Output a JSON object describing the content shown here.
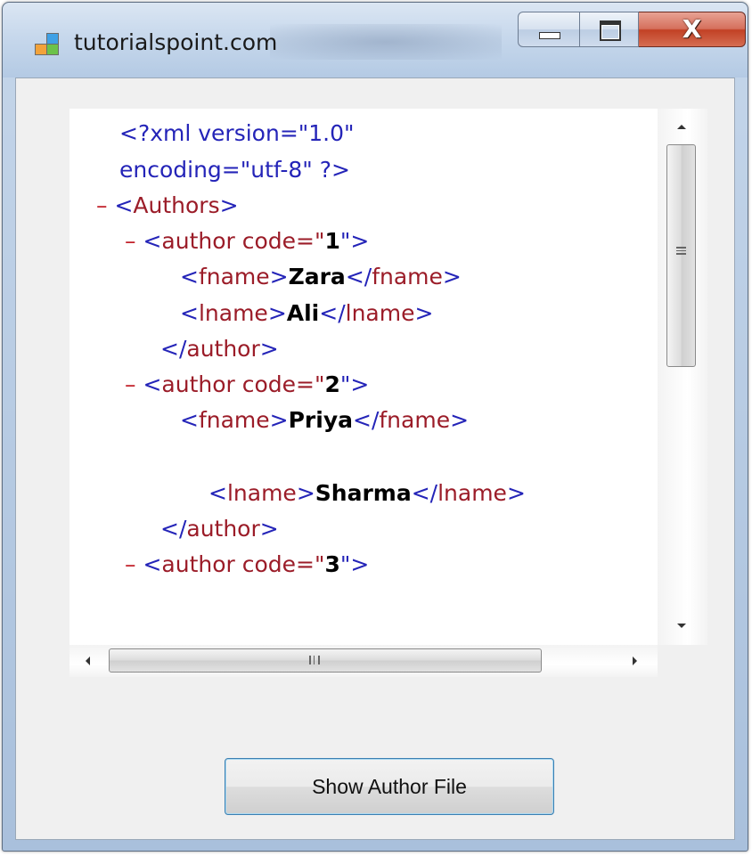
{
  "window": {
    "title": "tutorialspoint.com",
    "controls": {
      "minimize": "minimize",
      "maximize": "maximize",
      "close": "X"
    }
  },
  "xml_view": {
    "lines": [
      {
        "parts": [
          {
            "t": "<?xml version=\"1.0\"",
            "c": "b"
          }
        ]
      },
      {
        "parts": [
          {
            "t": "encoding=\"utf-8\" ?>",
            "c": "b"
          }
        ]
      },
      {
        "parts": [
          {
            "t": "– ",
            "c": "minus"
          },
          {
            "t": "<",
            "c": "b"
          },
          {
            "t": "Authors",
            "c": "r"
          },
          {
            "t": ">",
            "c": "b"
          }
        ]
      },
      {
        "parts": [
          {
            "t": "– ",
            "c": "minus"
          },
          {
            "t": "<",
            "c": "b"
          },
          {
            "t": "author",
            "c": "r"
          },
          {
            "t": " code=\"",
            "c": "r"
          },
          {
            "t": "1",
            "c": "k"
          },
          {
            "t": "\">",
            "c": "b"
          }
        ]
      },
      {
        "parts": [
          {
            "t": "<",
            "c": "b"
          },
          {
            "t": "fname",
            "c": "r"
          },
          {
            "t": ">",
            "c": "b"
          },
          {
            "t": "Zara",
            "c": "k"
          },
          {
            "t": "</",
            "c": "b"
          },
          {
            "t": "fname",
            "c": "r"
          },
          {
            "t": ">",
            "c": "b"
          }
        ]
      },
      {
        "parts": [
          {
            "t": "<",
            "c": "b"
          },
          {
            "t": "lname",
            "c": "r"
          },
          {
            "t": ">",
            "c": "b"
          },
          {
            "t": "Ali",
            "c": "k"
          },
          {
            "t": "</",
            "c": "b"
          },
          {
            "t": "lname",
            "c": "r"
          },
          {
            "t": ">",
            "c": "b"
          }
        ]
      },
      {
        "parts": [
          {
            "t": "</",
            "c": "b"
          },
          {
            "t": "author",
            "c": "r"
          },
          {
            "t": ">",
            "c": "b"
          }
        ]
      },
      {
        "parts": [
          {
            "t": "– ",
            "c": "minus"
          },
          {
            "t": "<",
            "c": "b"
          },
          {
            "t": "author",
            "c": "r"
          },
          {
            "t": " code=\"",
            "c": "r"
          },
          {
            "t": "2",
            "c": "k"
          },
          {
            "t": "\">",
            "c": "b"
          }
        ]
      },
      {
        "parts": [
          {
            "t": "<",
            "c": "b"
          },
          {
            "t": "fname",
            "c": "r"
          },
          {
            "t": ">",
            "c": "b"
          },
          {
            "t": "Priya",
            "c": "k"
          },
          {
            "t": "</",
            "c": "b"
          },
          {
            "t": "fname",
            "c": "r"
          },
          {
            "t": ">",
            "c": "b"
          }
        ]
      },
      {
        "parts": [
          {
            "t": "<",
            "c": "b"
          },
          {
            "t": "lname",
            "c": "r"
          },
          {
            "t": ">",
            "c": "b"
          },
          {
            "t": "Sharma",
            "c": "k"
          },
          {
            "t": "</",
            "c": "b"
          },
          {
            "t": "lname",
            "c": "r"
          },
          {
            "t": ">",
            "c": "b"
          }
        ]
      },
      {
        "parts": [
          {
            "t": "</",
            "c": "b"
          },
          {
            "t": "author",
            "c": "r"
          },
          {
            "t": ">",
            "c": "b"
          }
        ]
      },
      {
        "parts": [
          {
            "t": "– ",
            "c": "minus"
          },
          {
            "t": "<",
            "c": "b"
          },
          {
            "t": "author",
            "c": "r"
          },
          {
            "t": " code=\"",
            "c": "r"
          },
          {
            "t": "3",
            "c": "k"
          },
          {
            "t": "\">",
            "c": "b"
          }
        ]
      }
    ]
  },
  "scrollbars": {
    "vertical_position": 0.0,
    "horizontal_position": 0.0,
    "vertical_grip": "≡",
    "horizontal_grip": "III"
  },
  "button": {
    "show_author_file_label": "Show Author File"
  },
  "colors": {
    "markup_blue": "#2424b8",
    "tag_red": "#9b1c28",
    "collapse_minus": "#c2222b",
    "text_bold": "#000000",
    "titlebar": "#c7d8ec",
    "close_button": "#c24125"
  }
}
